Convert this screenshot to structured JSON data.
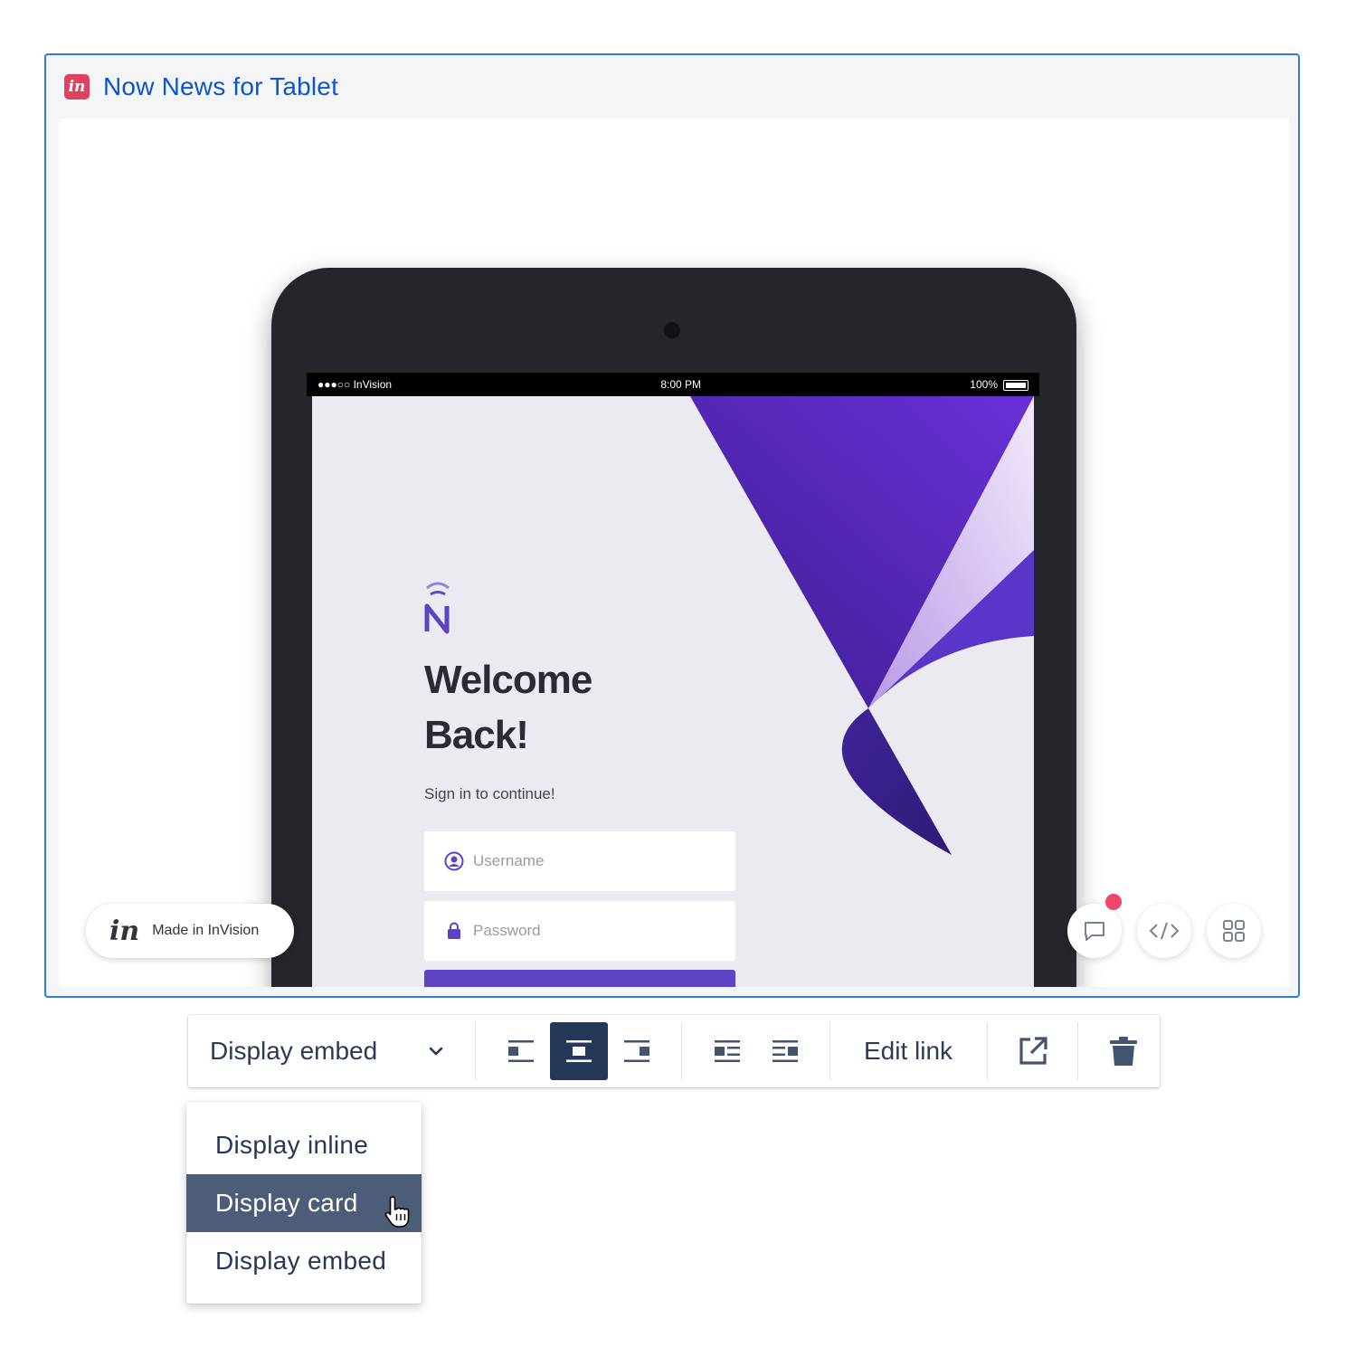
{
  "embed": {
    "title": "Now News for Tablet",
    "badge_icon": "invision-logo-icon",
    "accent_color": "#2f7bea"
  },
  "device": {
    "status_left": "●●●○○ InVision",
    "status_time": "8:00 PM",
    "status_battery": "100%"
  },
  "app_screen": {
    "heading_line1": "Welcome",
    "heading_line2": "Back!",
    "subtitle": "Sign in to continue!",
    "username_placeholder": "Username",
    "password_placeholder": "Password",
    "brand_color": "#5d43c4"
  },
  "overlay": {
    "made_in_logo": "in",
    "made_in_label": "Made in InVision",
    "buttons": [
      "comment-icon",
      "code-icon",
      "grid-icon"
    ]
  },
  "toolbar": {
    "display_select_value": "Display embed",
    "edit_link_label": "Edit link",
    "active_alignment": "center"
  },
  "dropdown": {
    "options": [
      "Display inline",
      "Display card",
      "Display embed"
    ],
    "hovered_index": 1
  }
}
